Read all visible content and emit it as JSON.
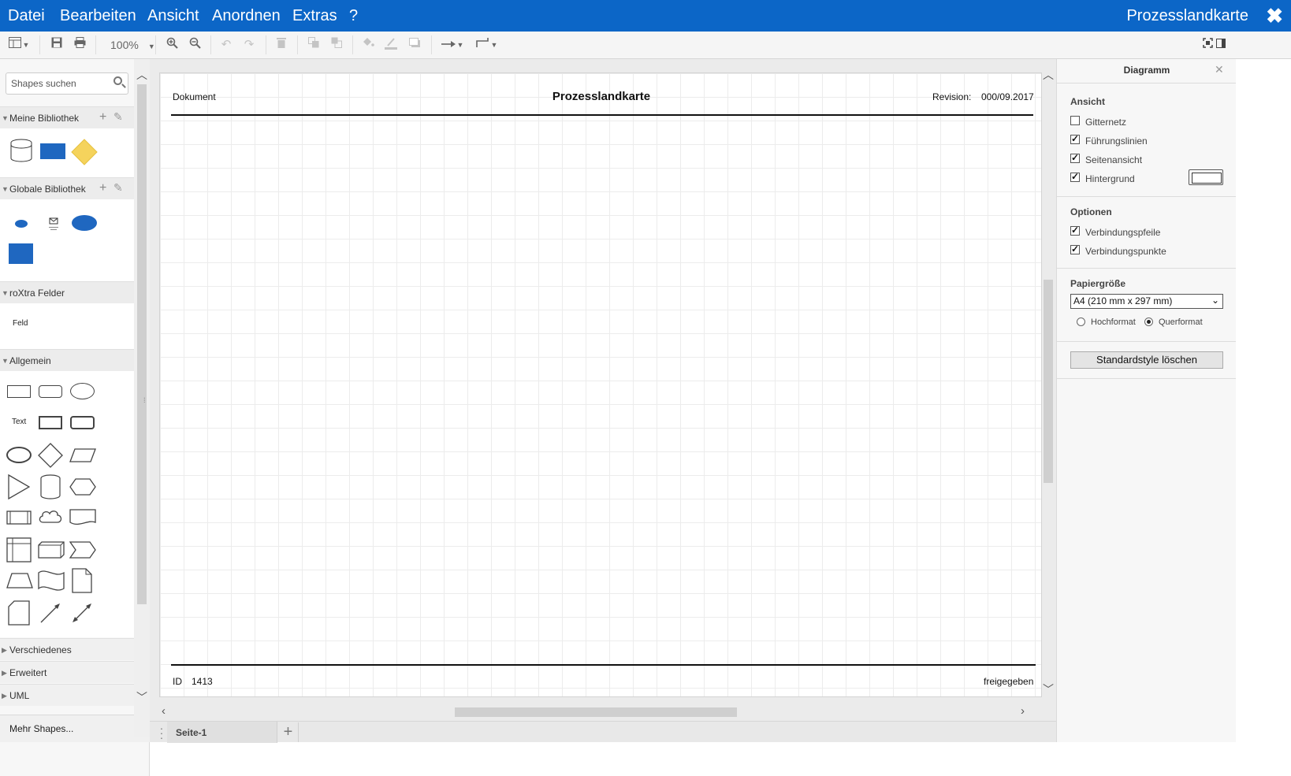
{
  "menubar": {
    "items": [
      "Datei",
      "Bearbeiten",
      "Ansicht",
      "Anordnen",
      "Extras",
      "?"
    ],
    "title": "Prozesslandkarte",
    "close_glyph": "✖"
  },
  "toolbar": {
    "zoom": "100%",
    "icons": [
      "format-panel-icon",
      "save-icon",
      "print-icon",
      "zoom-in-icon",
      "zoom-out-icon",
      "undo-icon",
      "redo-icon",
      "delete-icon",
      "to-front-icon",
      "to-back-icon",
      "fill-color-icon",
      "line-color-icon",
      "shadow-icon",
      "connection-icon",
      "waypoints-icon",
      "fullscreen-icon",
      "toggle-panel-icon"
    ]
  },
  "sidebar": {
    "search_placeholder": "Shapes suchen",
    "sections": {
      "meine": "Meine Bibliothek",
      "globale": "Globale Bibliothek",
      "roxtra": "roXtra Felder",
      "allgemein": "Allgemein",
      "verschiedenes": "Verschiedenes",
      "erweitert": "Erweitert",
      "uml": "UML"
    },
    "roxtra_field": "Feld",
    "general_text_shape": "Text",
    "more_shapes": "Mehr Shapes..."
  },
  "page": {
    "header_left": "Dokument",
    "title": "Prozesslandkarte",
    "revision_label": "Revision:",
    "revision_value": "000/09.2017",
    "footer_id_label": "ID",
    "footer_id_value": "1413",
    "footer_status": "freigegeben"
  },
  "pagebar": {
    "tab": "Seite-1",
    "add": "+"
  },
  "panel": {
    "title": "Diagramm",
    "ansicht_title": "Ansicht",
    "gitternetz": "Gitternetz",
    "fuehrungslinien": "Führungslinien",
    "seitenansicht": "Seitenansicht",
    "hintergrund": "Hintergrund",
    "optionen_title": "Optionen",
    "verbindungspfeile": "Verbindungspfeile",
    "verbindungspunkte": "Verbindungspunkte",
    "papiergroesse_title": "Papiergröße",
    "paper_size": "A4 (210 mm x 297 mm)",
    "hochformat": "Hochformat",
    "querformat": "Querformat",
    "reset_button": "Standardstyle löschen",
    "checks": {
      "gitternetz": false,
      "fuehrungslinien": true,
      "seitenansicht": true,
      "hintergrund": true,
      "verbindungspfeile": true,
      "verbindungspunkte": true
    },
    "orientation": "Querformat"
  },
  "colors": {
    "brand_blue": "#0c66c7",
    "shape_blue": "#1f67c0",
    "diamond_yellow": "#f5d35c"
  }
}
